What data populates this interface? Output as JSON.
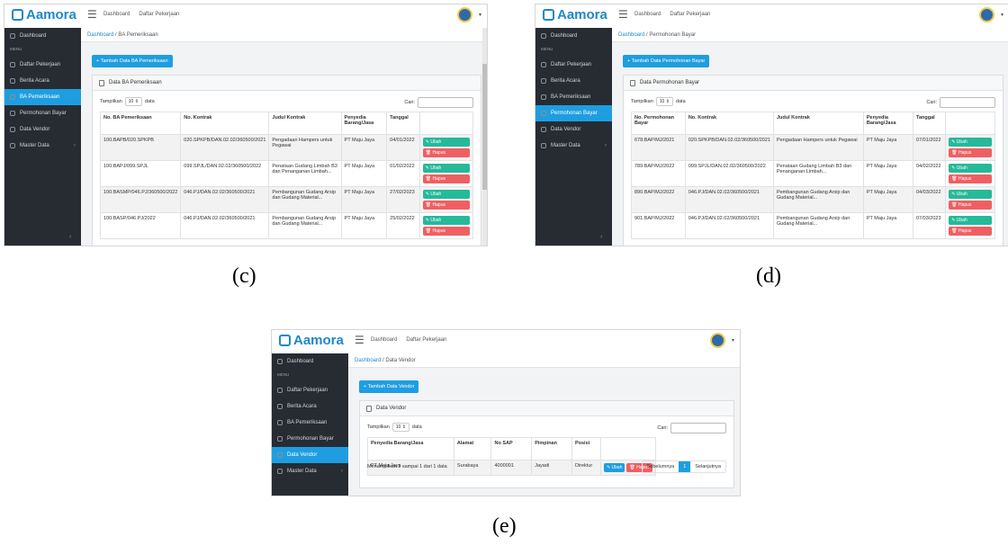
{
  "app": {
    "brand": "Aamora"
  },
  "topnav": {
    "dashboard": "Dashboard",
    "tasks": "Daftar Pekerjaan"
  },
  "sidebar": {
    "dashboard": "Dashboard",
    "menu": "MENU",
    "daftar_pekerjaan": "Daftar Pekerjaan",
    "berita_acara": "Berita Acara",
    "ba_pemeriksaan": "BA Pemeriksaan",
    "permohonan_bayar": "Permohonan Bayar",
    "data_vendor": "Data Vendor",
    "master_data": "Master Data"
  },
  "common": {
    "show": "Tampilkan",
    "length": "10",
    "data": "data",
    "search": "Cari:",
    "ubah": "Ubah",
    "hapus": "Hapus"
  },
  "panel_c": {
    "caption": "(c)",
    "crumb_home": "Dashboard",
    "crumb_current": "BA Pemeriksaan",
    "add_button": "Tambah Data BA Pemeriksaan",
    "card_title": "Data BA Pemeriksaan",
    "columns": [
      "No. BA Pemeriksaan",
      "No. Kontrak",
      "Judul Kontrak",
      "Penyedia Barang/Jasa",
      "Tanggal"
    ],
    "rows": [
      [
        "100.BAPB/020.SPKPB",
        "020.SPKPB/DAN.02.02/360500/2021",
        "Pengadaan Hampers untuk Pegawai",
        "PT Maju Jaya",
        "04/01/2022"
      ],
      [
        "100.BAPJ/099.SPJL",
        "099.SPJL/DAN.02.02/360500/2022",
        "Penataan Gudang Limbah B3 dan Penanganan Limbah...",
        "PT Maju Jaya",
        "01/02/2022"
      ],
      [
        "100.BASMP/046.PJ/360500/2022",
        "046.PJ/DAN.02.02/360500/2021",
        "Pembangunan Gudang Arsip dan Gudang Material...",
        "PT Maju Jaya",
        "27/02/2023"
      ],
      [
        "100.BASP/046.PJ/2022",
        "046.PJ/DAN.02.02/360500/2021",
        "Pembangunan Gudang Arsip dan Gudang Material...",
        "PT Maju Jaya",
        "25/02/2022"
      ]
    ]
  },
  "panel_d": {
    "caption": "(d)",
    "crumb_home": "Dashboard",
    "crumb_current": "Permohonan Bayar",
    "add_button": "Tambah Data Permohonan Bayar",
    "card_title": "Data Permohonan Bayar",
    "columns": [
      "No. Permohonan Bayar",
      "No. Kontrak",
      "Judul Kontrak",
      "Penyedia Barang/Jasa",
      "Tanggal"
    ],
    "rows": [
      [
        "678.BAP/MJ/2021",
        "020.SPKPB/DAN.02.02/360500/2021",
        "Pengadaan Hampers untuk Pegawai",
        "PT Maju Jaya",
        "07/01/2022"
      ],
      [
        "789.BAP/MJ/2022",
        "099.SPJL/DAN.02.02/360500/2022",
        "Penataan Gudang Limbah B3 dan Penanganan Limbah...",
        "PT Maju Jaya",
        "04/02/2022"
      ],
      [
        "890.BAP/MJ/2022",
        "046.PJ/DAN.02.02/360500/2021",
        "Pembangunan Gudang Arsip dan Gudang Material...",
        "PT Maju Jaya",
        "04/03/2022"
      ],
      [
        "901.BAP/MJ/2022",
        "046.PJ/DAN.02.02/360500/2021",
        "Pembangunan Gudang Arsip dan Gudang Material...",
        "PT Maju Jaya",
        "07/03/2023"
      ]
    ]
  },
  "panel_e": {
    "caption": "(e)",
    "crumb_home": "Dashboard",
    "crumb_current": "Data Vendor",
    "add_button": "Tambah Data Vendor",
    "card_title": "Data Vendor",
    "columns": [
      "Penyedia Barang/Jasa",
      "Alamat",
      "No SAP",
      "Pimpinan",
      "Posisi"
    ],
    "rows": [
      [
        "PT Maju Jaya",
        "Surabaya",
        "4000001",
        "Jayadi",
        "Direktur"
      ]
    ],
    "info": "Menampilkan 1 sampai 1 dari 1 data",
    "prev": "Sebelumnya",
    "page": "1",
    "next": "Selanjutnya"
  }
}
